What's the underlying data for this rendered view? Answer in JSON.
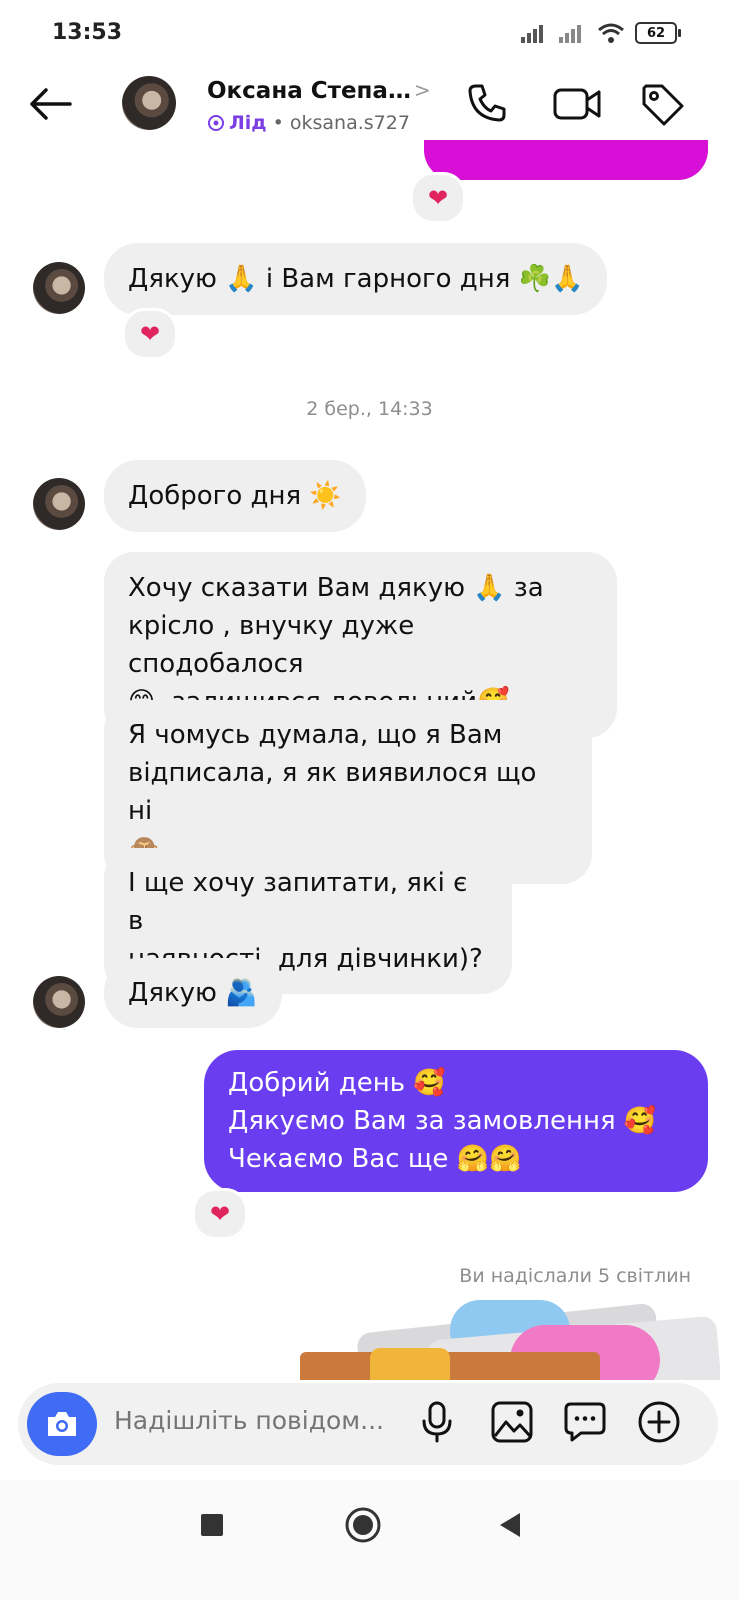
{
  "status_bar": {
    "time": "13:53",
    "battery": "62"
  },
  "header": {
    "name": "Оксана Степа…",
    "lead_label": "Лід",
    "username": "• oksana.s727"
  },
  "messages": {
    "m1": "Дякую 🙏 і Вам гарного дня ☘️🙏",
    "timestamp": "2 бер., 14:33",
    "m2": "Доброго дня ☀️",
    "m3_line1": "Хочу сказати Вам дякую 🙏 за",
    "m3_line2": "крісло , внучку дуже сподобалося",
    "m3_line3": "😊, залишився довольний🥰",
    "m4_line1": "Я чомусь думала, що я Вам",
    "m4_line2": "відписала, я як виявилося що ні",
    "m4_line3": "🙈",
    "m5_line1": "І ще хочу запитати, які є в",
    "m5_line2": "наявності, для дівчинки)?",
    "m6": "Дякую 🫂",
    "out_line1": "Добрий день 🥰",
    "out_line2": "Дякуємо Вам за замовлення 🥰",
    "out_line3": "Чекаємо Вас ще 🤗🤗",
    "reaction": "❤",
    "sent_note": "Ви надіслали 5 світлин"
  },
  "composer": {
    "placeholder": "Надішліть повідом..."
  },
  "icons": {
    "back": "back-arrow-icon",
    "call": "phone-icon",
    "video": "video-icon",
    "tag": "tag-icon",
    "camera": "camera-icon",
    "mic": "microphone-icon",
    "gallery": "image-icon",
    "sticker": "chat-bubble-icon",
    "plus": "plus-icon"
  },
  "colors": {
    "accent": "#6a3ef0",
    "camera": "#3f6bf5",
    "lead": "#7b3fe4",
    "heart": "#e0245e"
  }
}
